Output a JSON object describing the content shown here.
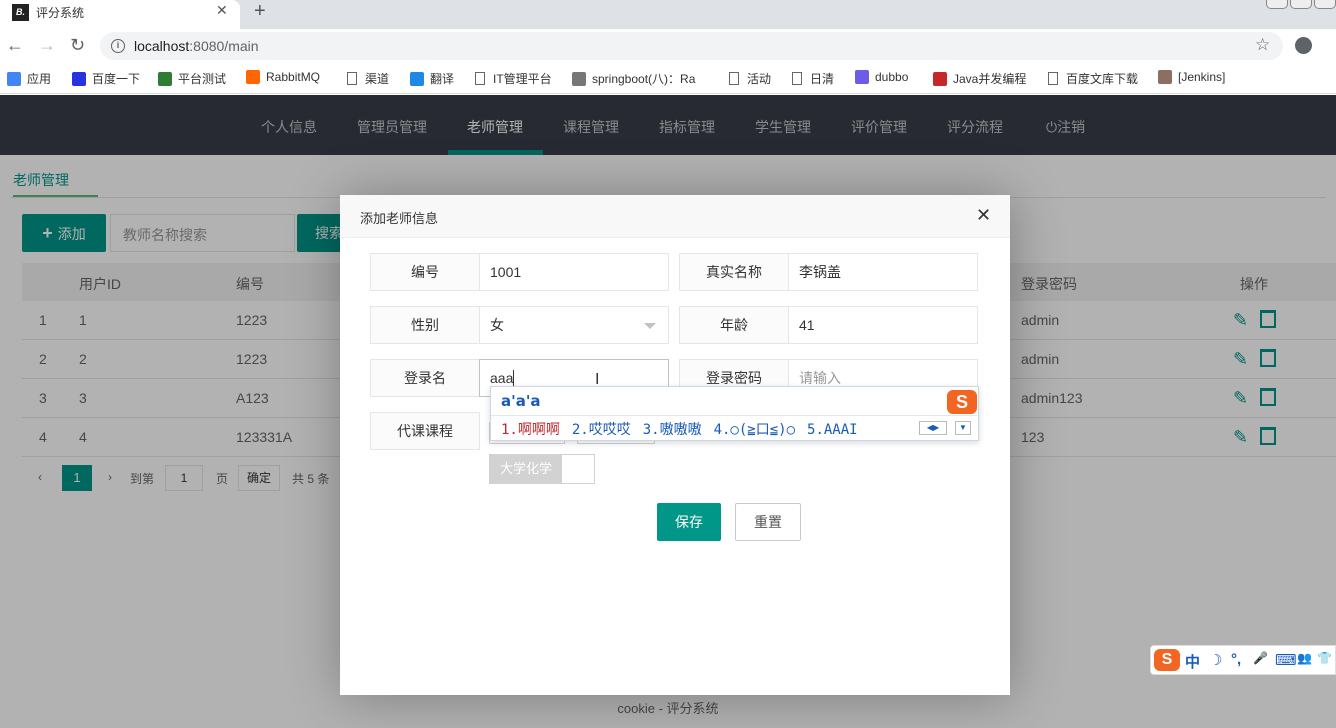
{
  "browser": {
    "tab_title": "评分系统",
    "tab_favicon": "B.",
    "url_host": "localhost",
    "url_rest": ":8080/main",
    "bookmarks": [
      {
        "label": "应用",
        "icon": "apps-icon",
        "color": "#4285f4"
      },
      {
        "label": "百度一下",
        "icon": "baidu-icon",
        "color": "#2932e1"
      },
      {
        "label": "平台测试",
        "icon": "platform-icon",
        "color": "#2e7d32"
      },
      {
        "label": "RabbitMQ",
        "icon": "rabbitmq-icon",
        "color": "#ff6600"
      },
      {
        "label": "渠道",
        "icon": "page-icon",
        "color": ""
      },
      {
        "label": "翻译",
        "icon": "translate-icon",
        "color": "#1e88e5"
      },
      {
        "label": "IT管理平台",
        "icon": "page-icon",
        "color": ""
      },
      {
        "label": "springboot(八)：Ra",
        "icon": "springboot-icon",
        "color": "#777777"
      },
      {
        "label": "活动",
        "icon": "page-icon",
        "color": ""
      },
      {
        "label": "日清",
        "icon": "page-icon",
        "color": ""
      },
      {
        "label": "dubbo",
        "icon": "dubbo-icon",
        "color": "#6c5ce7"
      },
      {
        "label": "Java并发编程",
        "icon": "csdn-icon",
        "color": "#c62828"
      },
      {
        "label": "百度文库下载",
        "icon": "page-icon",
        "color": ""
      },
      {
        "label": "[Jenkins]",
        "icon": "jenkins-icon",
        "color": "#8d6e63"
      }
    ]
  },
  "nav": {
    "items": [
      "个人信息",
      "管理员管理",
      "老师管理",
      "课程管理",
      "指标管理",
      "学生管理",
      "评价管理",
      "评分流程",
      "注销"
    ],
    "active": "老师管理",
    "logout_icon": "power-icon"
  },
  "list": {
    "subtab": "老师管理",
    "add_label": "添加",
    "search_placeholder": "教师名称搜索",
    "search_label": "搜索",
    "columns": [
      "用户ID",
      "编号",
      "登录密码",
      "操作"
    ],
    "rows": [
      {
        "idx": "1",
        "id": "1",
        "code": "1223",
        "password": "admin"
      },
      {
        "idx": "2",
        "id": "2",
        "code": "1223",
        "password": "admin"
      },
      {
        "idx": "3",
        "id": "3",
        "code": "A123",
        "password": "admin123"
      },
      {
        "idx": "4",
        "id": "4",
        "code": "123331A",
        "password": "123"
      }
    ],
    "pager": {
      "current": "1",
      "goto_label": "到第",
      "page_input": "1",
      "page_unit": "页",
      "confirm": "确定",
      "total": "共 5 条"
    }
  },
  "footer": "cookie - 评分系统",
  "modal": {
    "title": "添加老师信息",
    "fields": {
      "code_label": "编号",
      "code_value": "1001",
      "realname_label": "真实名称",
      "realname_value": "李锅盖",
      "gender_label": "性别",
      "gender_value": "女",
      "age_label": "年龄",
      "age_value": "41",
      "login_label": "登录名",
      "login_value": "aaa",
      "password_label": "登录密码",
      "password_placeholder": "请输入",
      "course_label": "代课课程",
      "course_options": [
        "大学化学"
      ]
    },
    "save_label": "保存",
    "reset_label": "重置"
  },
  "ime": {
    "composition": "a'a'a",
    "candidates": [
      "1.啊啊啊",
      "2.哎哎哎",
      "3.嗷嗷嗷",
      "4.○(≧口≦)○",
      "5.AAAI"
    ],
    "logo": "S",
    "status": [
      "中",
      "☽",
      "°,",
      "🎤",
      "⌨",
      "👥",
      "👕"
    ]
  },
  "colors": {
    "accent": "#009688",
    "nav_bg": "#393d49"
  }
}
